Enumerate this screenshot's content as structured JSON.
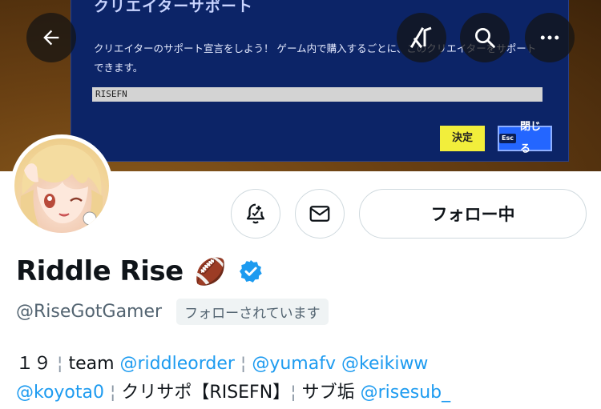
{
  "banner": {
    "game_title": "クリエイターサポート",
    "game_description": "クリエイターのサポート宣言をしよう！ ゲーム内で購入するごとに、このクリエイターをサポートできます。",
    "creator_code": "RISEFN",
    "confirm_label": "決定",
    "close_key": "Esc",
    "close_label": "閉じる"
  },
  "top_bar": {
    "back_icon": "arrow-left-icon",
    "grok_icon": "grok-icon",
    "search_icon": "search-icon",
    "more_icon": "more-icon"
  },
  "actions": {
    "notify_icon": "bell-plus-icon",
    "message_icon": "envelope-icon",
    "follow_label": "フォロー中"
  },
  "profile": {
    "name": "Riddle Rise",
    "emoji": "🏈",
    "verified_icon": "verified-badge-icon",
    "handle": "@RiseGotGamer",
    "follows_you": "フォローされています",
    "bio": {
      "line1": {
        "age": "１９",
        "sep1": "¦",
        "team_text": "team",
        "mention1": "@riddleorder",
        "sep2": "¦",
        "mention2": "@yumafv",
        "mention3": "@keikiww"
      },
      "line2": {
        "mention4": "@koyota0",
        "sep3": "¦",
        "creator_text": "クリサポ【RISEFN】",
        "sep4": "¦",
        "sub_text": "サブ垢",
        "mention5": "@risesub_"
      }
    }
  },
  "colors": {
    "accent": "#1d9bf0",
    "text_primary": "#0f1419",
    "text_secondary": "#536471",
    "border": "#cfd9de",
    "game_panel": "#0c2467"
  }
}
